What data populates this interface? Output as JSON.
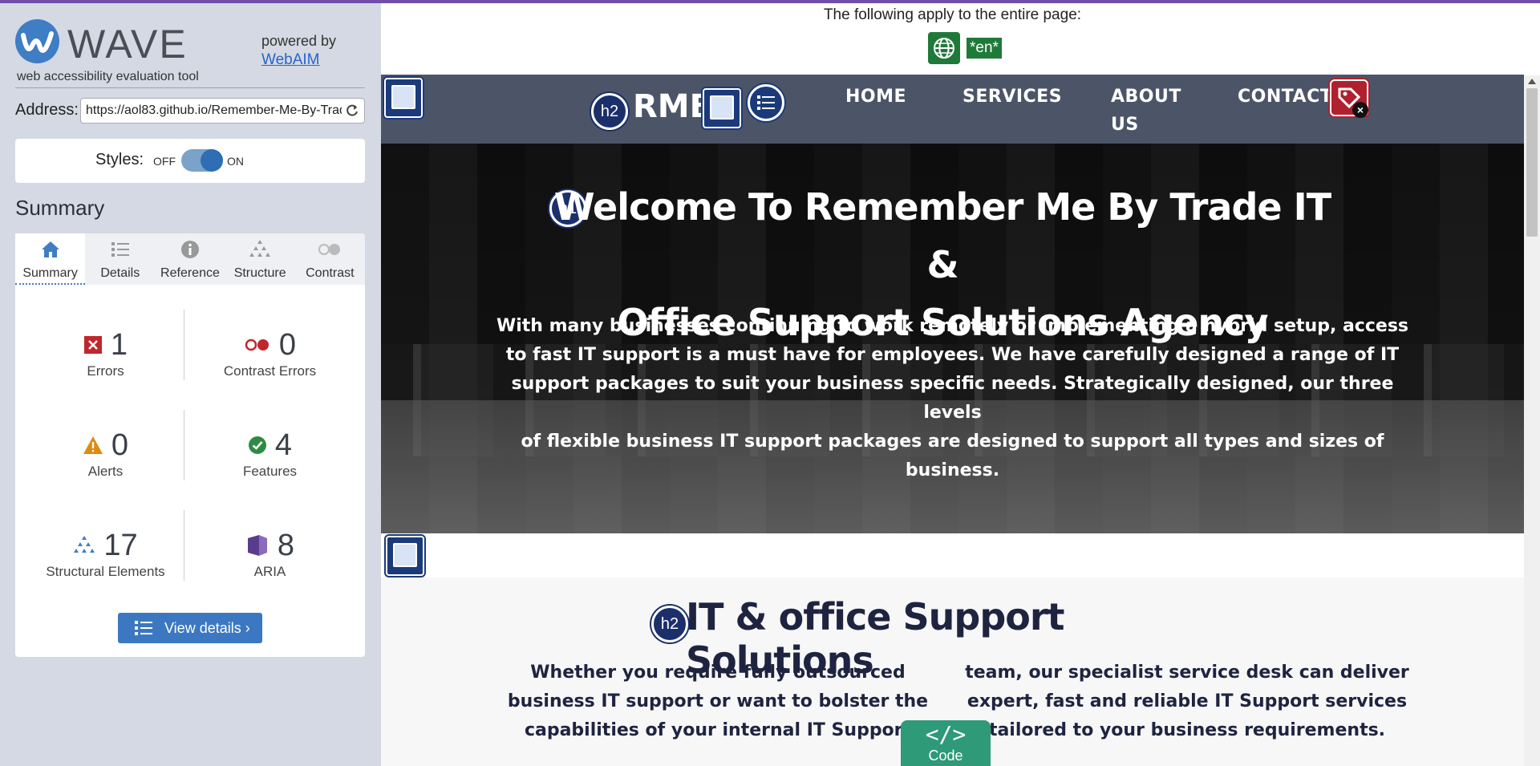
{
  "sidebar": {
    "brand": "WAVE",
    "subtitle": "web accessibility evaluation tool",
    "powered_by": "powered by",
    "webaim_link": "WebAIM",
    "address_label": "Address:",
    "address_value": "https://aol83.github.io/Remember-Me-By-Trade/",
    "styles_label": "Styles:",
    "styles_off": "OFF",
    "styles_on": "ON",
    "styles_state": "on",
    "summary_heading": "Summary",
    "tabs": [
      {
        "label": "Summary",
        "icon": "home-icon",
        "active": true
      },
      {
        "label": "Details",
        "icon": "list-icon",
        "active": false
      },
      {
        "label": "Reference",
        "icon": "info-icon",
        "active": false
      },
      {
        "label": "Structure",
        "icon": "hierarchy-icon",
        "active": false
      },
      {
        "label": "Contrast",
        "icon": "contrast-icon",
        "active": false
      }
    ],
    "stats": {
      "errors": {
        "count": "1",
        "label": "Errors"
      },
      "contrast": {
        "count": "0",
        "label": "Contrast Errors"
      },
      "alerts": {
        "count": "0",
        "label": "Alerts"
      },
      "features": {
        "count": "4",
        "label": "Features"
      },
      "structural": {
        "count": "17",
        "label": "Structural Elements"
      },
      "aria": {
        "count": "8",
        "label": "ARIA"
      }
    },
    "view_details": "View details ›",
    "colors": {
      "panel_bg": "#d4d9e3",
      "accent": "#3c78c2",
      "error": "#c0272d",
      "alert": "#e08a10",
      "feature": "#2e8b45",
      "aria": "#5a3c8c"
    }
  },
  "preview": {
    "apply_text": "The following apply to the entire page:",
    "lang_badge": "*en*",
    "brand": "RMB",
    "nav": [
      "HOME",
      "SERVICES",
      "ABOUT",
      "US",
      "CONTACT"
    ],
    "h1_badge": "h1",
    "h2_badge": "h2",
    "hero_title_line1": "Welcome To Remember Me By Trade IT &",
    "hero_title_line2": "Office Support Solutions Agency",
    "hero_body_lines": [
      "With many businesses continuing to work remotely or implementing a hybrid setup, access",
      "to fast IT support is a must have for employees. We have carefully designed a range of IT",
      "support packages to suit your business specific needs. Strategically designed, our three levels",
      "of flexible business IT support packages are designed to support all types and sizes of",
      "business."
    ],
    "section_title": "IT & office Support Solutions",
    "col_left_lines": [
      "Whether you require fully outsourced",
      "business IT support or want to bolster the",
      "capabilities of your internal IT Support"
    ],
    "col_right_lines": [
      "team, our specialist service desk can deliver",
      "expert, fast and reliable IT Support services",
      "tailored to your business requirements."
    ],
    "code_symbol": "</>",
    "code_label": "Code"
  }
}
